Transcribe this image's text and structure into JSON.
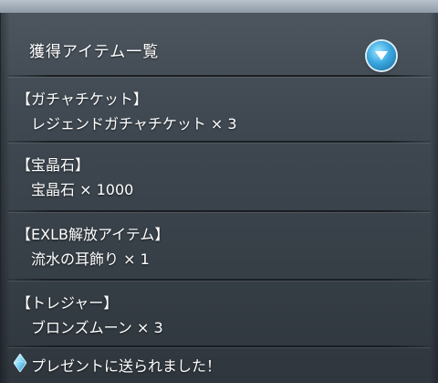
{
  "header": {
    "title": "獲得アイテム一覧",
    "toggle_icon": "chevron-down-icon"
  },
  "items": [
    {
      "category": "【ガチャチケット】",
      "line": "レジェンドガチャチケット × 3"
    },
    {
      "category": "【宝晶石】",
      "line": "宝晶石 × 1000"
    },
    {
      "category": "【EXLB解放アイテム】",
      "line": "流水の耳飾り × 1"
    },
    {
      "category": "【トレジャー】",
      "line": "ブロンズムーン × 3"
    }
  ],
  "footer": {
    "message": "プレゼントに送られました！",
    "icon": "crystal-icon"
  },
  "colors": {
    "panel": "#3f4851",
    "text": "#ffffff",
    "accent_button": "#3aa8e0"
  }
}
